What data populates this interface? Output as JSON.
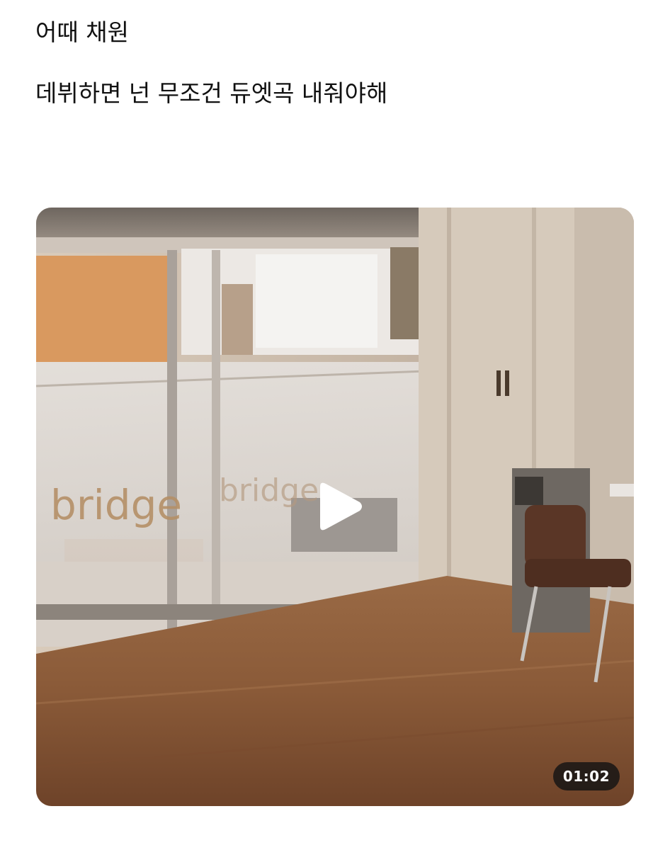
{
  "post": {
    "lines": [
      "어때 채원",
      "데뷔하면 넌 무조건 듀엣곡 내줘야해"
    ]
  },
  "video": {
    "duration": "01:02",
    "play_icon": "play-icon",
    "sign_text_left": "bridge",
    "sign_text_right": "bridge"
  },
  "colors": {
    "text": "#111111",
    "badge_bg": "#141414",
    "badge_text": "#ffffff"
  }
}
